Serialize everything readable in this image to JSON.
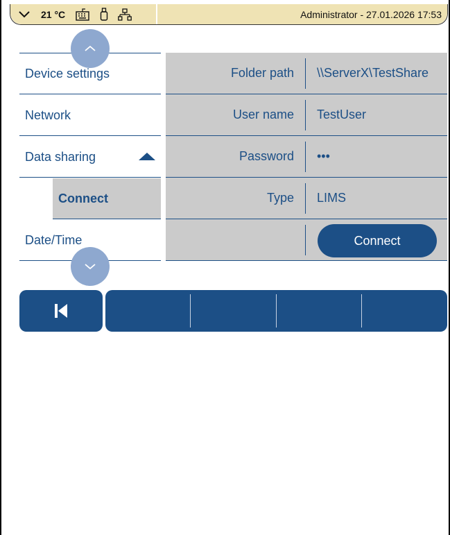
{
  "statusbar": {
    "temperature": "21 °C",
    "icons": [
      "chevron-down-icon",
      "keyboard-icon",
      "usb-icon",
      "network-icon"
    ],
    "user_datetime": "Administrator - 27.01.2026 17:53"
  },
  "nav": {
    "items": [
      {
        "label": "Device settings"
      },
      {
        "label": "Network"
      },
      {
        "label": "Data sharing",
        "expanded": true
      },
      {
        "label": "Connect",
        "selected": true,
        "sub": true
      },
      {
        "label": "Date/Time"
      }
    ]
  },
  "form": {
    "rows": [
      {
        "label": "Folder path",
        "value": "\\\\ServerX\\TestShare"
      },
      {
        "label": "User name",
        "value": "TestUser"
      },
      {
        "label": "Password",
        "value": "•••"
      },
      {
        "label": "Type",
        "value": "LIMS"
      }
    ],
    "connect_label": "Connect"
  },
  "toolbar": {
    "back_icon": "skip-back-icon"
  },
  "colors": {
    "accent": "#1c4f86",
    "panel": "#cbcbcb",
    "statusbar": "#efe3b4",
    "scroll_button": "#8ea8cf"
  }
}
